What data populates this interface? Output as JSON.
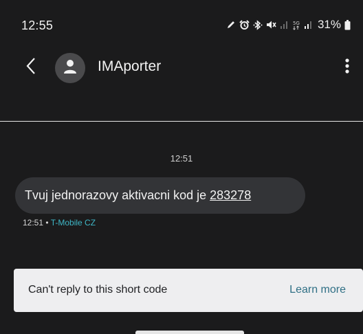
{
  "status_bar": {
    "time": "12:55",
    "battery": "31%",
    "icons": [
      "pencil-icon",
      "alarm-icon",
      "bluetooth-icon",
      "mute-icon",
      "signal-icon",
      "5g-icon",
      "signal-icon",
      "battery-icon"
    ]
  },
  "header": {
    "contact_name": "IMAporter",
    "back_icon": "chevron-left-icon",
    "avatar_icon": "person-icon",
    "more_icon": "more-vert-icon"
  },
  "conversation": {
    "date_stamp": "12:51",
    "messages": [
      {
        "text": "Tvuj jednorazovy aktivacni kod je",
        "code": "283278",
        "time": "12:51",
        "separator": "•",
        "carrier": "T-Mobile CZ"
      }
    ]
  },
  "reply_banner": {
    "text": "Can't reply to this short code",
    "action": "Learn more"
  },
  "colors": {
    "background": "#1b1b1c",
    "bubble": "#333437",
    "carrier_accent": "#3fb8c8",
    "banner": "#eeeef0",
    "link": "#2f6f85"
  }
}
